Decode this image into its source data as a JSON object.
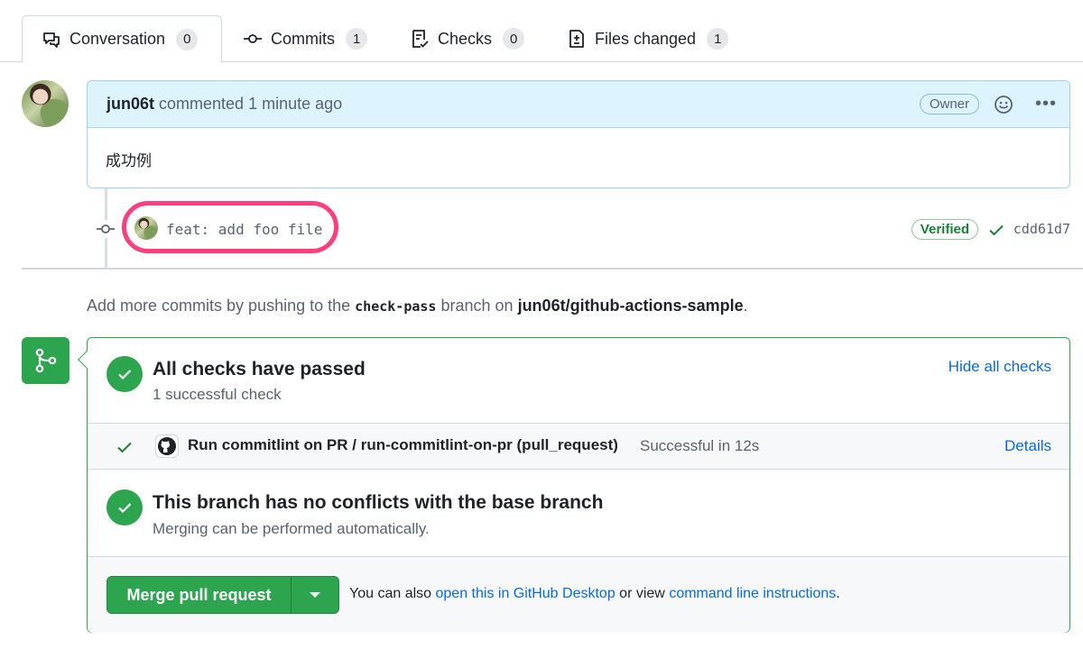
{
  "tabs": [
    {
      "label": "Conversation",
      "count": "0",
      "icon": "comment-discussion-icon"
    },
    {
      "label": "Commits",
      "count": "1",
      "icon": "git-commit-icon"
    },
    {
      "label": "Checks",
      "count": "0",
      "icon": "checklist-icon"
    },
    {
      "label": "Files changed",
      "count": "1",
      "icon": "file-diff-icon"
    }
  ],
  "comment": {
    "author": "jun06t",
    "action": "commented",
    "time": "1 minute ago",
    "badge": "Owner",
    "body": "成功例"
  },
  "commit": {
    "message": "feat: add foo file",
    "verified": "Verified",
    "sha": "cdd61d7"
  },
  "hint": {
    "prefix": "Add more commits by pushing to the",
    "branch": "check-pass",
    "middle": "branch on",
    "repo": "jun06t/github-actions-sample",
    "suffix": "."
  },
  "checks": {
    "title": "All checks have passed",
    "subtitle": "1 successful check",
    "hide_label": "Hide all checks",
    "item_name": "Run commitlint on PR / run-commitlint-on-pr (pull_request)",
    "item_status": "Successful in 12s",
    "details_label": "Details"
  },
  "conflicts": {
    "title": "This branch has no conflicts with the base branch",
    "subtitle": "Merging can be performed automatically."
  },
  "merge": {
    "button_label": "Merge pull request",
    "note_prefix": "You can also",
    "link1": "open this in GitHub Desktop",
    "note_middle": "or view",
    "link2": "command line instructions",
    "note_suffix": "."
  },
  "colors": {
    "success": "#2da44e",
    "link": "#0969da",
    "highlight": "#ff3e7b",
    "comment_header": "#ddf4ff"
  }
}
